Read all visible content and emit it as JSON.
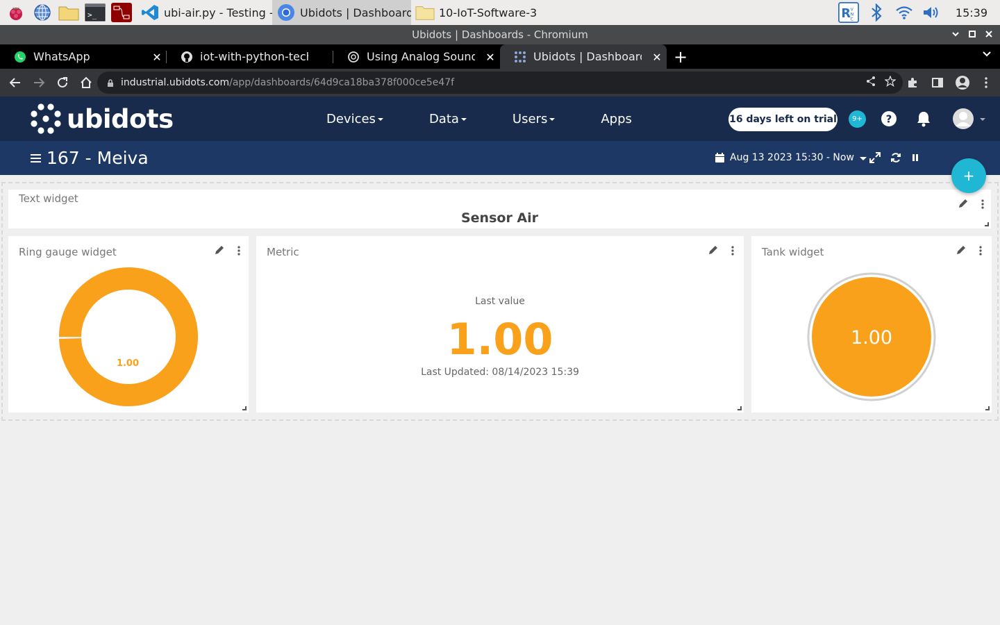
{
  "taskbar": {
    "tasks": [
      {
        "label": "ubi-air.py - Testing - ..."
      },
      {
        "label": "Ubidots | Dashboard..."
      },
      {
        "label": "10-IoT-Software-3"
      }
    ],
    "clock": "15:39"
  },
  "window": {
    "title": "Ubidots | Dashboards - Chromium"
  },
  "tabs": [
    {
      "label": "WhatsApp"
    },
    {
      "label": "iot-with-python-technical"
    },
    {
      "label": "Using Analog Sound Sen"
    },
    {
      "label": "Ubidots | Dashboards"
    }
  ],
  "address": {
    "host": "industrial.ubidots.com",
    "path": "/app/dashboards/64d9ca18ba378f000ce5e47f"
  },
  "header": {
    "logo_text": "ubidots",
    "nav": [
      {
        "label": "Devices"
      },
      {
        "label": "Data"
      },
      {
        "label": "Users"
      },
      {
        "label": "Apps"
      }
    ],
    "trial": "16 days left on trial",
    "notifications": "9+"
  },
  "dashboard": {
    "name": "167 - Meiva",
    "date_range": "Aug 13 2023 15:30 - Now",
    "add_label": "+"
  },
  "widgets": {
    "text": {
      "title": "Text widget",
      "content": "Sensor Air"
    },
    "ring": {
      "title": "Ring gauge widget",
      "value_text": "1.00",
      "fraction": 0.995
    },
    "metric": {
      "title": "Metric",
      "label": "Last value",
      "value": "1.00",
      "updated": "Last Updated: 08/14/2023 15:39"
    },
    "tank": {
      "title": "Tank widget",
      "value": "1.00"
    }
  },
  "colors": {
    "accent": "#f9a11b",
    "header_bg": "#182b4d",
    "subheader_bg": "#1e3866",
    "teal": "#1fb7d4"
  }
}
